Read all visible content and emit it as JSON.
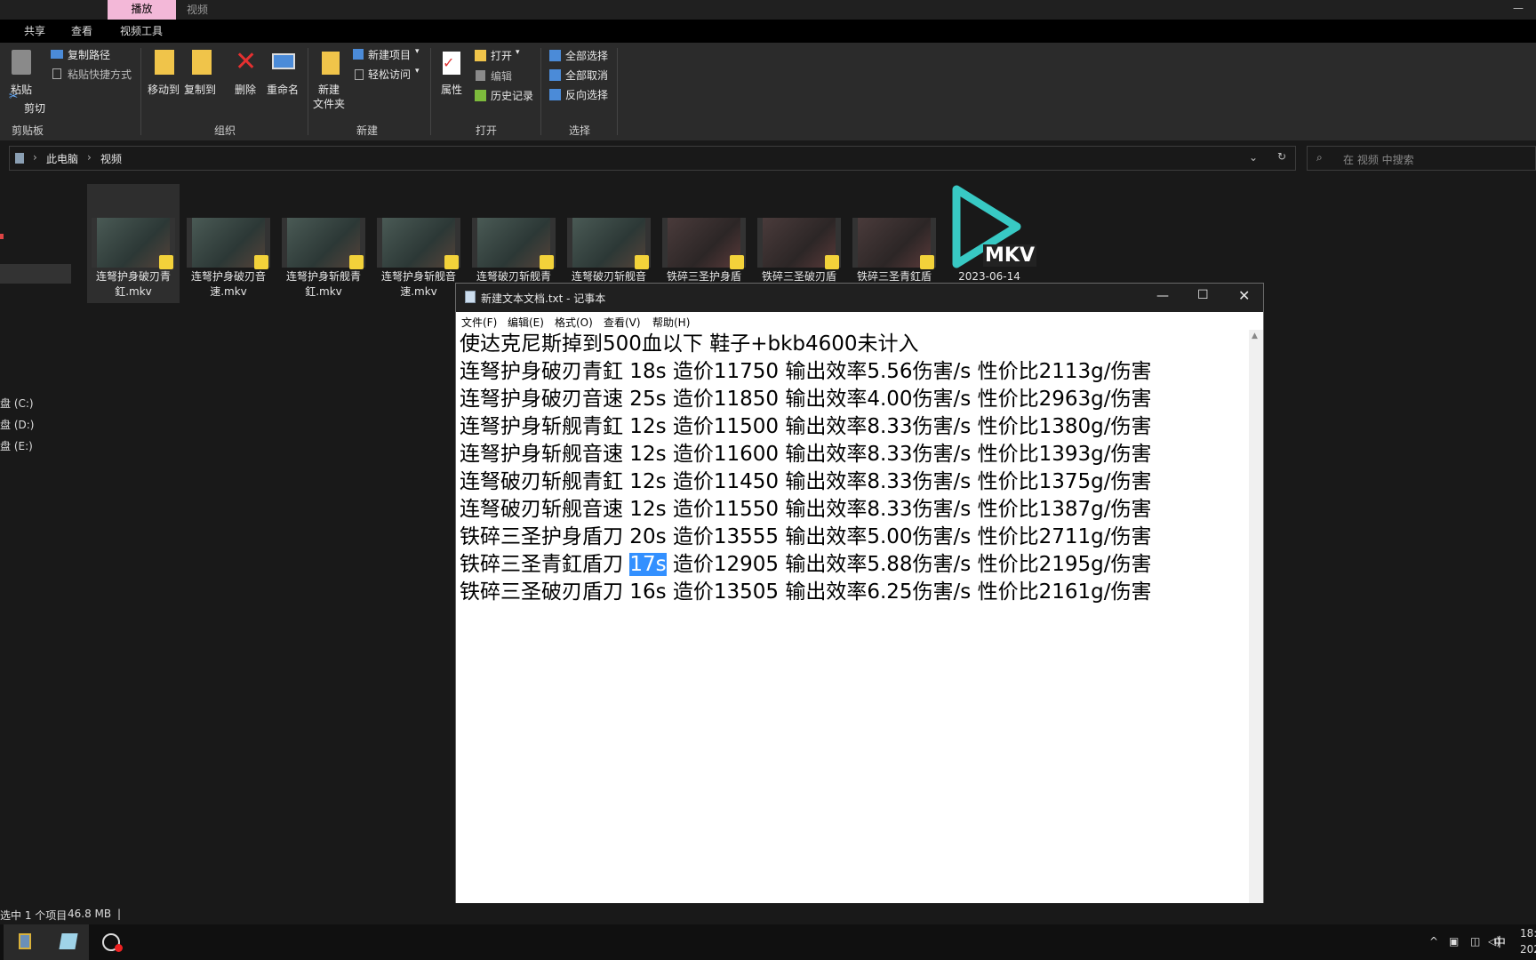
{
  "ribbon_tabs": {
    "context_tab": "播放",
    "context_tab2": "视频",
    "share": "共享",
    "view": "查看",
    "video_tools": "视频工具"
  },
  "ribbon": {
    "paste": "粘贴",
    "copy_path": "复制路径",
    "paste_shortcut": "粘贴快捷方式",
    "cut": "剪切",
    "clipboard": "剪贴板",
    "move_to": "移动到",
    "copy_to": "复制到",
    "delete": "删除",
    "rename": "重命名",
    "organize": "组织",
    "new_folder": "新建\n文件夹",
    "new_item": "新建项目",
    "easy_access": "轻松访问",
    "new": "新建",
    "properties": "属性",
    "open": "打开",
    "edit": "编辑",
    "history": "历史记录",
    "open_group": "打开",
    "select_all": "全部选择",
    "select_none": "全部取消",
    "invert_selection": "反向选择",
    "select": "选择"
  },
  "address": {
    "crumb1": "此电脑",
    "crumb2": "视频",
    "search_placeholder": "在 视频 中搜索"
  },
  "nav": {
    "drive_c": "盘 (C:)",
    "drive_d": "盘 (D:)",
    "drive_e": "盘 (E:)"
  },
  "files": [
    {
      "name": "连弩护身破刃青\n釭.mkv"
    },
    {
      "name": "连弩护身破刃音\n速.mkv"
    },
    {
      "name": "连弩护身斩舰青\n釭.mkv"
    },
    {
      "name": "连弩护身斩舰音\n速.mkv"
    },
    {
      "name": "连弩破刃斩舰青"
    },
    {
      "name": "连弩破刃斩舰音"
    },
    {
      "name": "铁碎三圣护身盾"
    },
    {
      "name": "铁碎三圣破刃盾"
    },
    {
      "name": "铁碎三圣青釭盾"
    }
  ],
  "mkv_file": {
    "label": "MKV",
    "date": "2023-06-14"
  },
  "notepad": {
    "title": "新建文本文档.txt - 记事本",
    "menu": [
      "文件(F)",
      "编辑(E)",
      "格式(O)",
      "查看(V)",
      "帮助(H)"
    ],
    "lines": [
      "使达克尼斯掉到500血以下 鞋子+bkb4600未计入",
      "连弩护身破刃青釭 18s 造价11750 输出效率5.56伤害/s 性价比2113g/伤害",
      "连弩护身破刃音速 25s 造价11850 输出效率4.00伤害/s 性价比2963g/伤害",
      "连弩护身斩舰青釭 12s 造价11500 输出效率8.33伤害/s 性价比1380g/伤害",
      "连弩护身斩舰音速 12s 造价11600 输出效率8.33伤害/s 性价比1393g/伤害",
      "连弩破刃斩舰青釭 12s 造价11450 输出效率8.33伤害/s 性价比1375g/伤害",
      "连弩破刃斩舰音速 12s 造价11550 输出效率8.33伤害/s 性价比1387g/伤害",
      "铁碎三圣护身盾刀 20s 造价13555 输出效率5.00伤害/s 性价比2711g/伤害"
    ],
    "line9_pre": "铁碎三圣青釭盾刀 ",
    "line9_sel": "17s",
    "line9_post": " 造价12905 输出效率5.88伤害/s 性价比2195g/伤害",
    "line10": "铁碎三圣破刃盾刀 16s 造价13505 输出效率6.25伤害/s 性价比2161g/伤害"
  },
  "status": {
    "selected": "选中 1 个项目",
    "size": "46.8 MB"
  },
  "tray": {
    "ime": "中",
    "time_partial": "18:",
    "date_partial": "202"
  },
  "colors": {
    "selection": "#3390ff",
    "ribbon_context": "#f3b8d8",
    "mkv_accent": "#38c9c4"
  }
}
